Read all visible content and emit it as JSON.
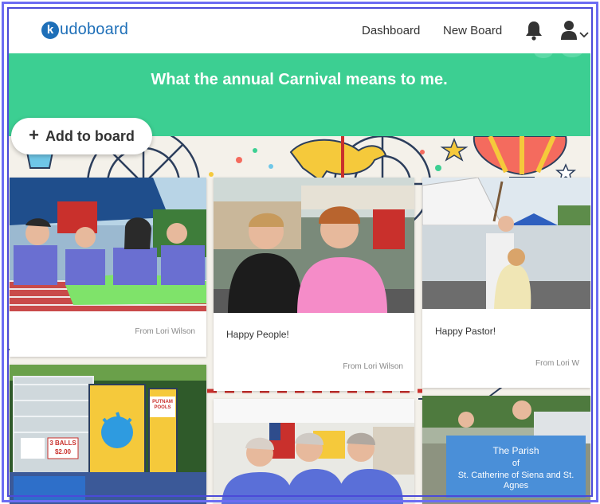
{
  "app": {
    "logo_letter": "k",
    "logo_text": "udoboard"
  },
  "nav": {
    "dashboard": "Dashboard",
    "new_board": "New Board"
  },
  "board": {
    "title": "What the annual Carnival means to me.",
    "header_color": "#3ccf92"
  },
  "actions": {
    "add_plus": "+",
    "add_label": "Add to board"
  },
  "posts": [
    {
      "message": "",
      "from": "From Lori Wilson"
    },
    {
      "message": "Happy People!",
      "from": "From Lori Wilson"
    },
    {
      "message": "Happy Pastor!",
      "from": "From Lori W"
    },
    {
      "message": "",
      "from": ""
    },
    {
      "message": "",
      "from": ""
    },
    {
      "message": "",
      "from": ""
    }
  ],
  "photo_text": {
    "dunk_sign": "PUTNAM POOLS",
    "balls_sign": "3 BALLS",
    "price_sign": "$2.00",
    "banner_line1": "The Parish",
    "banner_line2": "of",
    "banner_line3": "St. Catherine of Siena and St. Agnes"
  }
}
